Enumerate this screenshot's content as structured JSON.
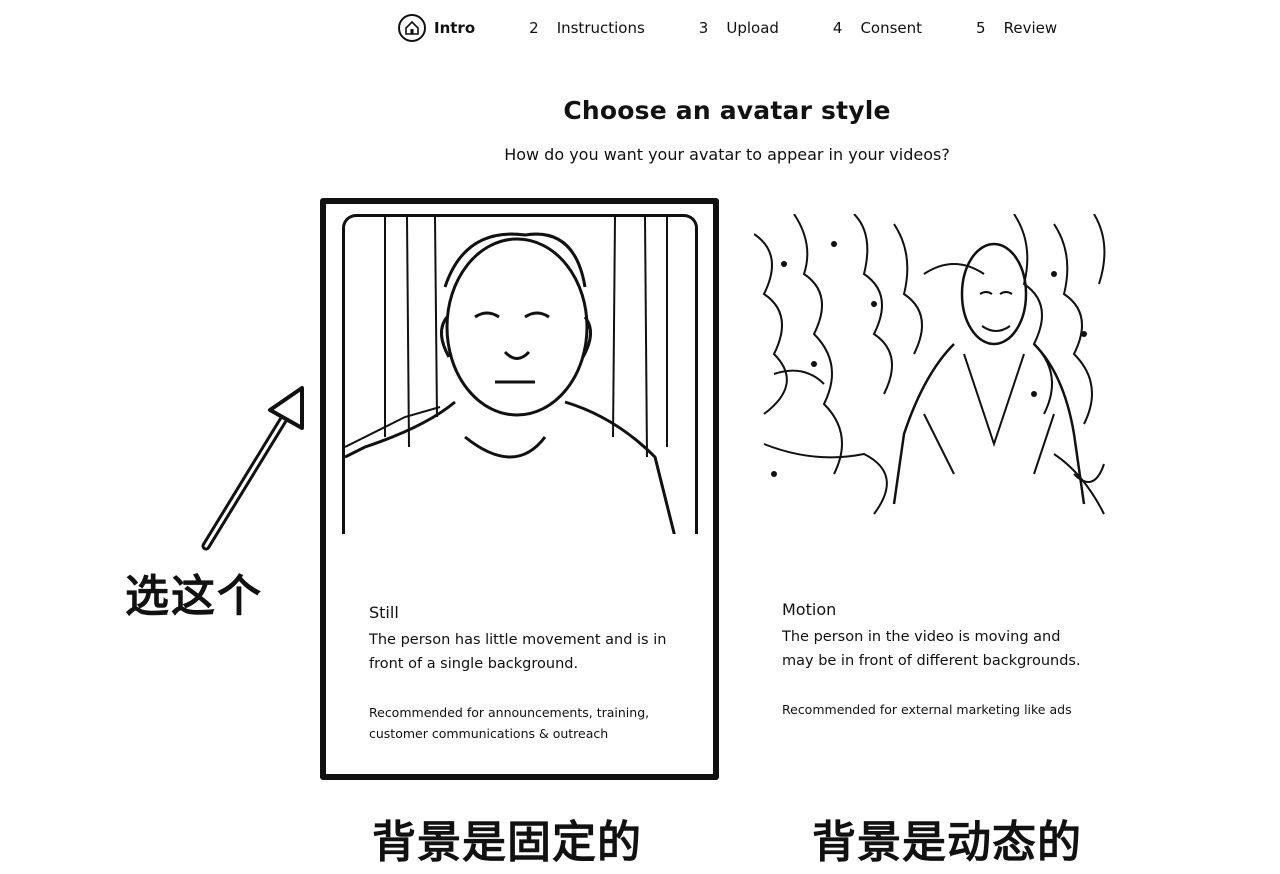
{
  "stepper": {
    "steps": [
      {
        "number": "",
        "label": "Intro",
        "icon": "home-icon"
      },
      {
        "number": "2",
        "label": "Instructions"
      },
      {
        "number": "3",
        "label": "Upload"
      },
      {
        "number": "4",
        "label": "Consent"
      },
      {
        "number": "5",
        "label": "Review"
      }
    ]
  },
  "main": {
    "title": "Choose an avatar style",
    "subtitle": "How do you want your avatar to appear in your videos?"
  },
  "cards": [
    {
      "title": "Still",
      "description": "The person has little movement and is in front of a single background.",
      "recommendation": "Recommended for announcements, training, customer communications & outreach",
      "selected": true
    },
    {
      "title": "Motion",
      "description": "The person in the video is moving and may be in front of different backgrounds.",
      "recommendation": "Recommended for external marketing like ads",
      "selected": false
    }
  ],
  "annotations": {
    "select_this": "选这个",
    "still_caption": "背景是固定的",
    "motion_caption": "背景是动态的"
  }
}
